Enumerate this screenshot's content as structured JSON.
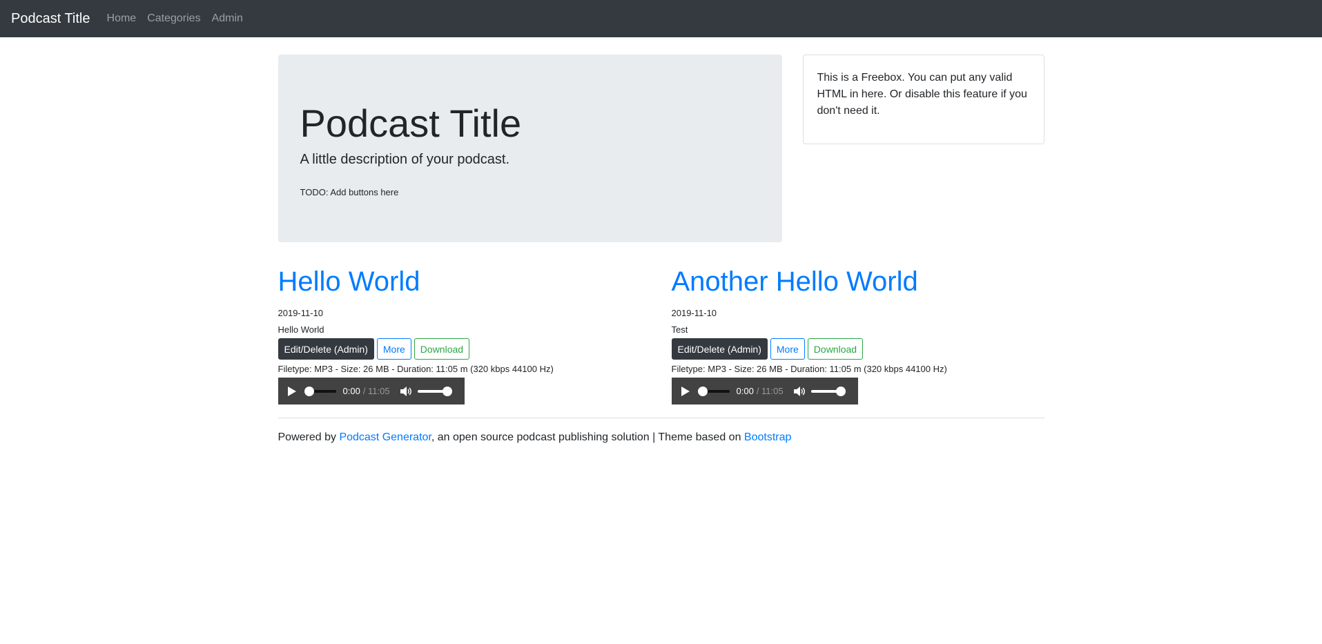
{
  "navbar": {
    "brand": "Podcast Title",
    "links": [
      "Home",
      "Categories",
      "Admin"
    ]
  },
  "jumbotron": {
    "title": "Podcast Title",
    "lead": "A little description of your podcast.",
    "todo": "TODO: Add buttons here"
  },
  "freebox": {
    "text": "This is a Freebox. You can put any valid HTML in here. Or disable this feature if you don't need it."
  },
  "episodes": [
    {
      "title": "Hello World",
      "date": "2019-11-10",
      "description": "Hello World",
      "edit_label": "Edit/Delete (Admin)",
      "more_label": "More",
      "download_label": "Download",
      "fileinfo": "Filetype: MP3 - Size: 26 MB - Duration: 11:05 m (320 kbps 44100 Hz)",
      "player": {
        "current": "0:00",
        "total": "/ 11:05",
        "progress": 0,
        "volume": 1
      }
    },
    {
      "title": "Another Hello World",
      "date": "2019-11-10",
      "description": "Test",
      "edit_label": "Edit/Delete (Admin)",
      "more_label": "More",
      "download_label": "Download",
      "fileinfo": "Filetype: MP3 - Size: 26 MB - Duration: 11:05 m (320 kbps 44100 Hz)",
      "player": {
        "current": "0:00",
        "total": "/ 11:05",
        "progress": 0,
        "volume": 1
      }
    }
  ],
  "footer": {
    "prefix": "Powered by ",
    "link1": "Podcast Generator",
    "middle": ", an open source podcast publishing solution | Theme based on ",
    "link2": "Bootstrap"
  },
  "colors": {
    "navbar": "#343a40",
    "link": "#007bff",
    "success": "#28a745",
    "jumbotron": "#e9ecef"
  }
}
